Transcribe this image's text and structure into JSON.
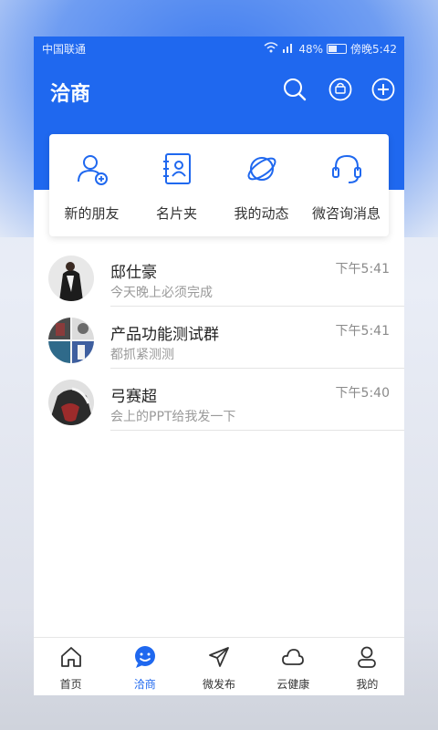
{
  "status_bar": {
    "carrier": "中国联通",
    "battery": "48%",
    "time": "傍晚5:42"
  },
  "header": {
    "title": "洽商",
    "accent": "#1f68ef"
  },
  "shortcuts": [
    {
      "label": "新的朋友",
      "icon": "add-friend-icon"
    },
    {
      "label": "名片夹",
      "icon": "contact-book-icon"
    },
    {
      "label": "我的动态",
      "icon": "orbit-icon"
    },
    {
      "label": "微咨询消息",
      "icon": "headset-icon"
    }
  ],
  "chats": [
    {
      "name": "邸仕豪",
      "time": "下午5:41",
      "message": "今天晚上必须完成"
    },
    {
      "name": "产品功能测试群",
      "time": "下午5:41",
      "message": "都抓紧测测"
    },
    {
      "name": "弓赛超",
      "time": "下午5:40",
      "message": "会上的PPT给我发一下"
    }
  ],
  "tabs": [
    {
      "label": "首页",
      "icon": "home-icon"
    },
    {
      "label": "洽商",
      "icon": "chat-smile-icon",
      "active": true
    },
    {
      "label": "微发布",
      "icon": "send-icon"
    },
    {
      "label": "云健康",
      "icon": "cloud-icon"
    },
    {
      "label": "我的",
      "icon": "person-icon"
    }
  ]
}
